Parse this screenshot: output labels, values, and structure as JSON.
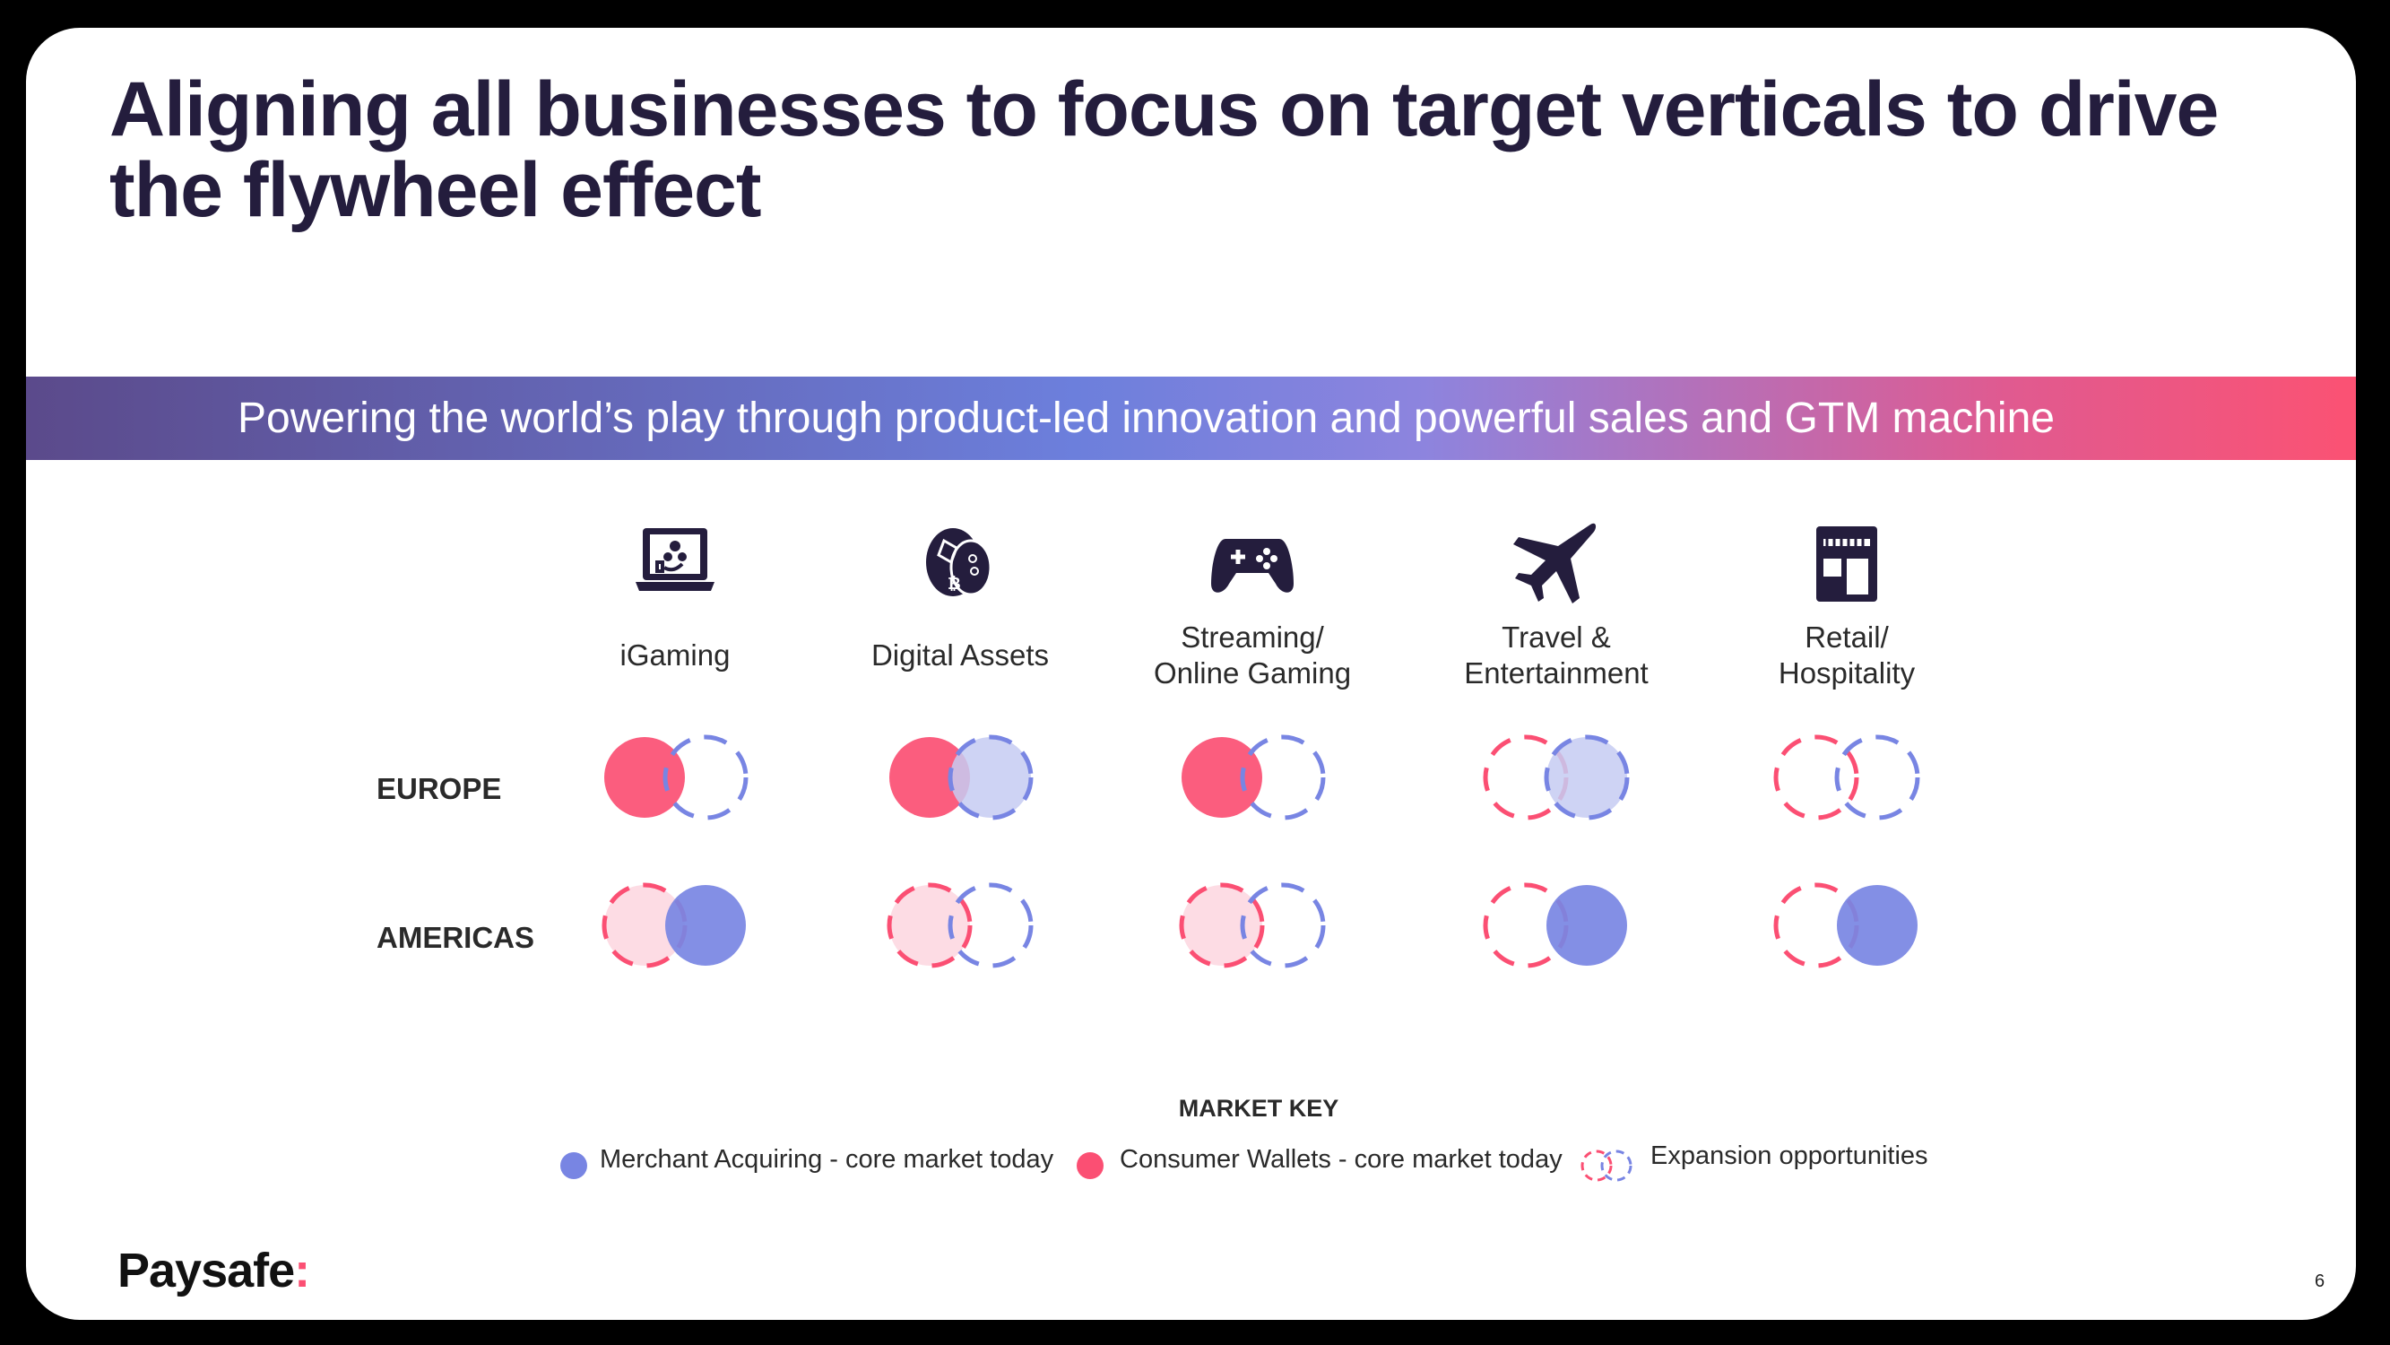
{
  "title": "Aligning all businesses to focus on target verticals to drive the flywheel effect",
  "banner": "Powering the world’s play through product-led innovation and powerful sales and GTM machine",
  "colors": {
    "merchant": "#7885e3",
    "merchant_light": "#c5cbf2",
    "wallet": "#fb4f73",
    "wallet_light": "#fdd6df",
    "text_dark": "#241d3d"
  },
  "verticals": [
    {
      "label_lines": [
        "iGaming"
      ],
      "icon": "laptop-gaming-icon"
    },
    {
      "label_lines": [
        "Digital Assets"
      ],
      "icon": "crypto-coins-icon"
    },
    {
      "label_lines": [
        "Streaming/",
        "Online Gaming"
      ],
      "icon": "gamepad-icon"
    },
    {
      "label_lines": [
        "Travel &",
        "Entertainment"
      ],
      "icon": "airplane-icon"
    },
    {
      "label_lines": [
        "Retail/",
        "Hospitality"
      ],
      "icon": "storefront-icon"
    }
  ],
  "regions": [
    {
      "label": "EUROPE",
      "cells": [
        {
          "wallet": "core",
          "merchant": "expansion"
        },
        {
          "wallet": "core",
          "merchant": "expansion-light"
        },
        {
          "wallet": "core",
          "merchant": "expansion"
        },
        {
          "wallet": "expansion",
          "merchant": "expansion-light"
        },
        {
          "wallet": "expansion",
          "merchant": "expansion"
        }
      ]
    },
    {
      "label": "AMERICAS",
      "cells": [
        {
          "wallet": "expansion-light",
          "merchant": "core"
        },
        {
          "wallet": "expansion-light",
          "merchant": "expansion"
        },
        {
          "wallet": "expansion-light",
          "merchant": "expansion"
        },
        {
          "wallet": "expansion",
          "merchant": "core"
        },
        {
          "wallet": "expansion",
          "merchant": "core"
        }
      ]
    }
  ],
  "market_key": {
    "title": "MARKET KEY",
    "merchant": "Merchant Acquiring - core market today",
    "wallet": "Consumer Wallets - core market today",
    "expansion": "Expansion opportunities"
  },
  "logo": {
    "name": "Paysafe",
    "mark": ":"
  },
  "page_number": "6"
}
